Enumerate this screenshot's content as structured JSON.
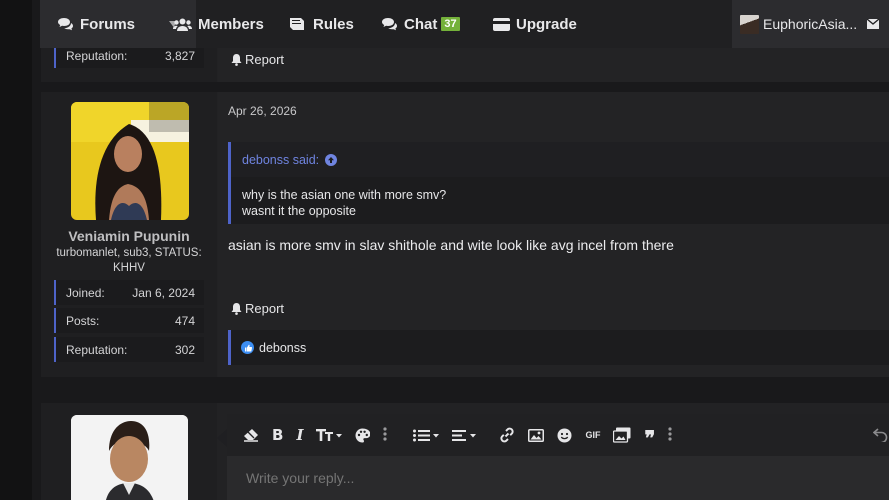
{
  "nav": {
    "forums": "Forums",
    "members": "Members",
    "rules": "Rules",
    "chat": "Chat",
    "chat_count": "37",
    "upgrade": "Upgrade",
    "user": "EuphoricAsia..."
  },
  "prev_post": {
    "reputation_label": "Reputation:",
    "reputation_value": "3,827",
    "report": "Report"
  },
  "post": {
    "date": "Apr 26, 2026",
    "username": "Veniamin Pupunin",
    "user_title": "turbomanlet, sub3, STATUS: KHHV",
    "stats": [
      {
        "label": "Joined:",
        "value": "Jan 6, 2024"
      },
      {
        "label": "Posts:",
        "value": "474"
      },
      {
        "label": "Reputation:",
        "value": "302"
      }
    ],
    "quote": {
      "author": "debonss said:",
      "lines": [
        "why is the asian one with more smv?",
        "wasnt it the opposite"
      ]
    },
    "message": "asian is more smv in slav shithole and wite look like avg incel from there",
    "report": "Report",
    "reaction_user": "debonss"
  },
  "reply": {
    "placeholder": "Write your reply..."
  },
  "colors": {
    "accent": "#4e63c9",
    "link": "#6f84e0",
    "chat_badge": "#74b13a",
    "like": "#3c8ef3"
  }
}
